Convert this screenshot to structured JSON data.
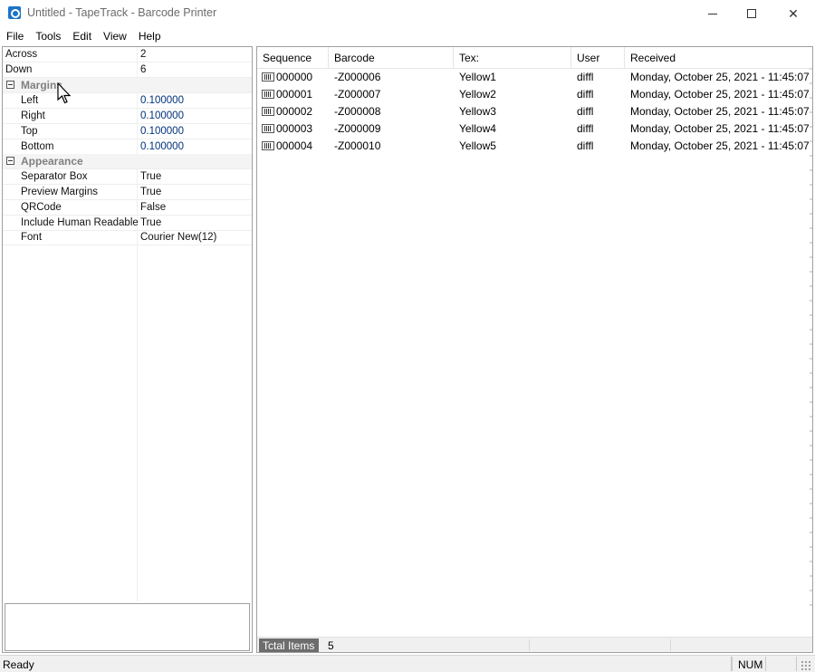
{
  "window": {
    "title": "Untitled - TapeTrack - Barcode Printer"
  },
  "menu": [
    "File",
    "Tools",
    "Edit",
    "View",
    "Help"
  ],
  "properties": {
    "rows": [
      {
        "name": "Across",
        "value": "2"
      },
      {
        "name": "Down",
        "value": "6"
      }
    ],
    "margins": {
      "label": "Margins",
      "rows": [
        {
          "name": "Left",
          "value": "0.100000"
        },
        {
          "name": "Right",
          "value": "0.100000"
        },
        {
          "name": "Top",
          "value": "0.100000"
        },
        {
          "name": "Bottom",
          "value": "0.100000"
        }
      ]
    },
    "appearance": {
      "label": "Appearance",
      "rows": [
        {
          "name": "Separator Box",
          "value": "True"
        },
        {
          "name": "Preview Margins",
          "value": "True"
        },
        {
          "name": "QRCode",
          "value": "False"
        },
        {
          "name": "Include Human Readable",
          "value": "True"
        },
        {
          "name": "Font",
          "value": "Courier New(12)"
        }
      ]
    }
  },
  "list": {
    "columns": [
      "Sequence",
      "Barcode",
      "Tex:",
      "User",
      "Received"
    ],
    "rows": [
      {
        "sequence": "000000",
        "barcode": "-Z000006",
        "text": "Yellow1",
        "user": "diffl",
        "received": "Monday, October 25, 2021 - 11:45:07"
      },
      {
        "sequence": "000001",
        "barcode": "-Z000007",
        "text": "Yellow2",
        "user": "diffl",
        "received": "Monday, October 25, 2021 - 11:45:07"
      },
      {
        "sequence": "000002",
        "barcode": "-Z000008",
        "text": "Yellow3",
        "user": "diffl",
        "received": "Monday, October 25, 2021 - 11:45:07"
      },
      {
        "sequence": "000003",
        "barcode": "-Z000009",
        "text": "Yellow4",
        "user": "diffl",
        "received": "Monday, October 25, 2021 - 11:45:07"
      },
      {
        "sequence": "000004",
        "barcode": "-Z000010",
        "text": "Yellow5",
        "user": "diffl",
        "received": "Monday, October 25, 2021 - 11:45:07"
      }
    ],
    "total_label": "Tctal Items",
    "total_value": "5"
  },
  "status": {
    "text": "Ready",
    "num": "NUM"
  }
}
